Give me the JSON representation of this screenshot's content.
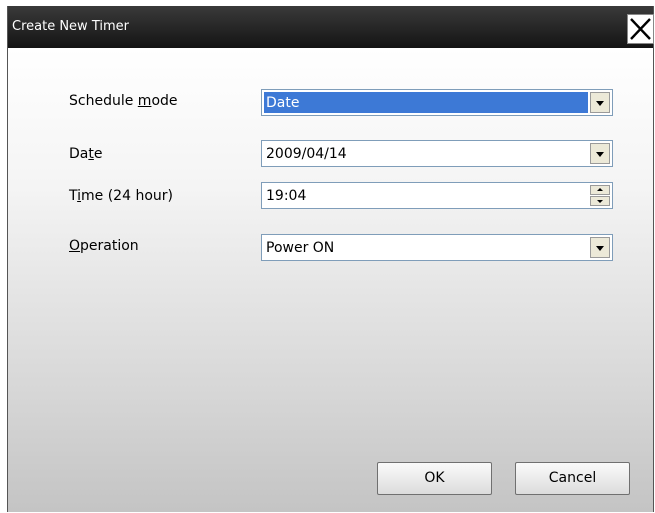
{
  "window": {
    "title": "Create New Timer",
    "close_icon": "close-icon"
  },
  "form": {
    "schedule_mode": {
      "label_pre": "Schedule ",
      "label_key": "m",
      "label_post": "ode",
      "value": "Date"
    },
    "date": {
      "label_pre": "Da",
      "label_key": "t",
      "label_post": "e",
      "value": "2009/04/14"
    },
    "time": {
      "label_pre": "T",
      "label_key": "i",
      "label_post": "me (24 hour)",
      "value": "19:04"
    },
    "operation": {
      "label_pre": "",
      "label_key": "O",
      "label_post": "peration",
      "value": "Power ON"
    }
  },
  "buttons": {
    "ok": "OK",
    "cancel": "Cancel"
  },
  "colors": {
    "selection": "#3d79d6",
    "titlebar": "#1e1e1e"
  }
}
